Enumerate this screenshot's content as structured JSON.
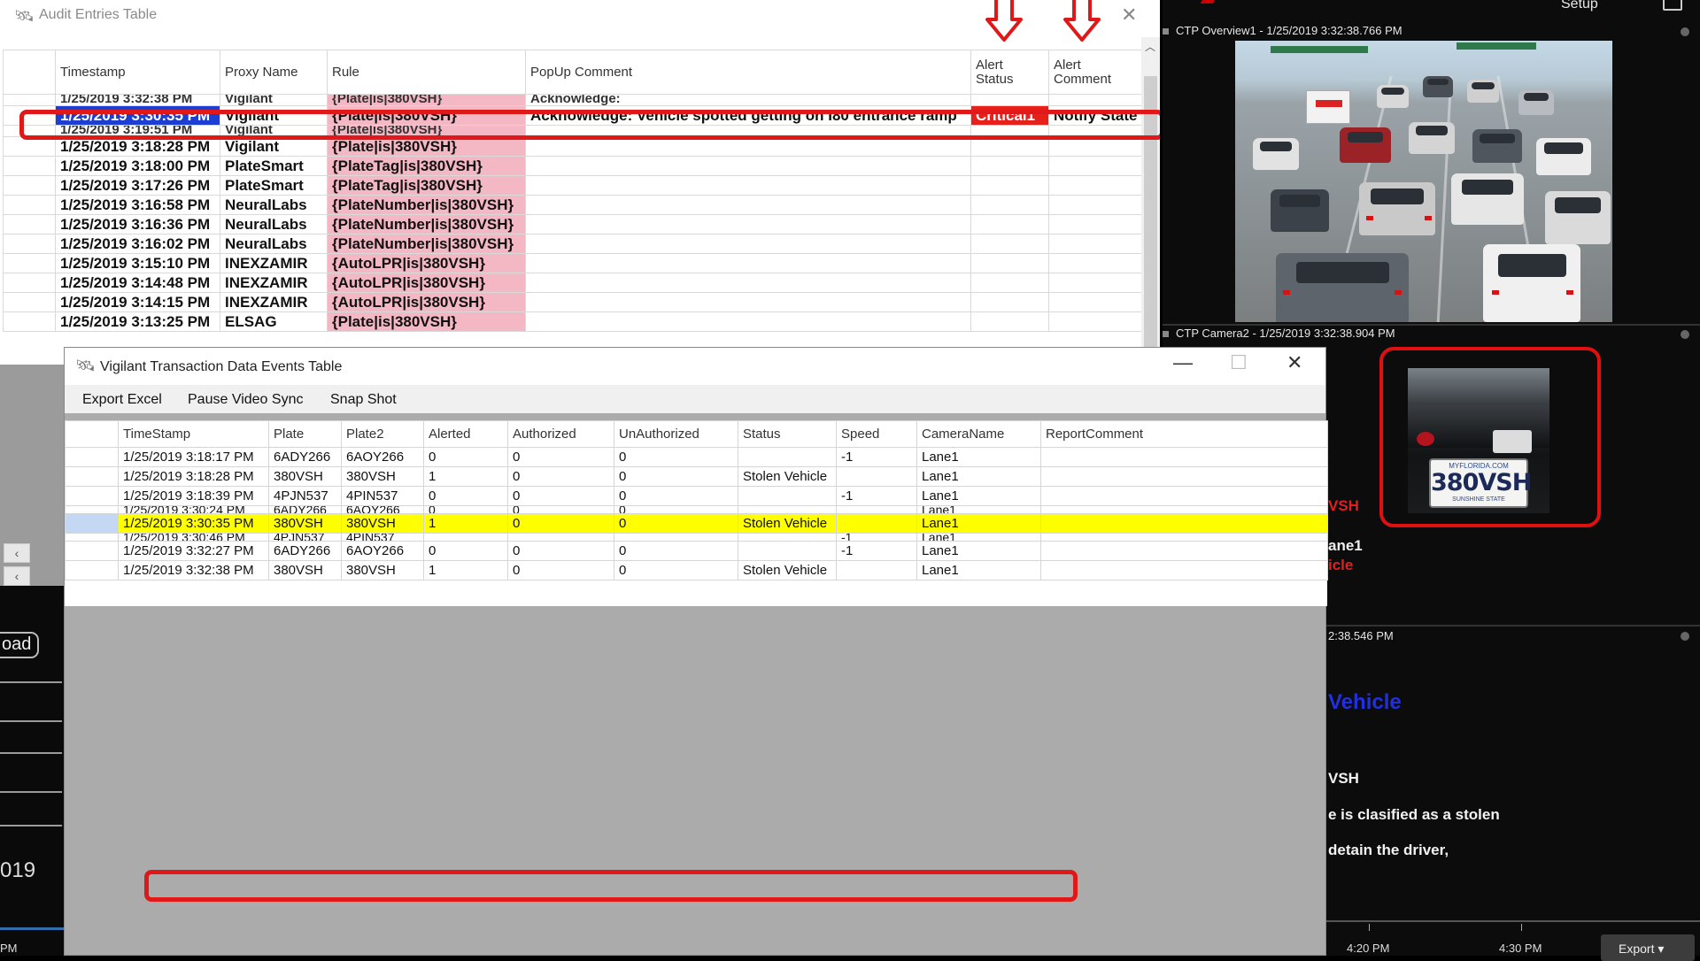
{
  "audit": {
    "title": "Audit Entries Table",
    "columns": [
      "",
      "Timestamp",
      "Proxy Name",
      "Rule",
      "PopUp Comment",
      "Alert Status",
      "Alert Comment"
    ],
    "top_partial": [
      "",
      "1/25/2019 3:32:38 PM",
      "Vigilant",
      "{Plate|is|380VSH}",
      "Acknowledge:",
      "",
      ""
    ],
    "selected_row": {
      "timestamp": "1/25/2019 3:30:35 PM",
      "proxy": "Vigilant",
      "rule": "{Plate|is|380VSH}",
      "comment": "Acknowledge: Vehicle spotted getting on I80 entrance ramp",
      "status": "Critical1",
      "alert_comment": "Notify State"
    },
    "partial_after": [
      "",
      "1/25/2019 3:19:51 PM",
      "Vigilant",
      "{Plate|is|380VSH}",
      "",
      "",
      ""
    ],
    "rows": [
      [
        "1/25/2019 3:18:28 PM",
        "Vigilant",
        "{Plate|is|380VSH}"
      ],
      [
        "1/25/2019 3:18:00 PM",
        "PlateSmart",
        "{PlateTag|is|380VSH}"
      ],
      [
        "1/25/2019 3:17:26 PM",
        "PlateSmart",
        "{PlateTag|is|380VSH}"
      ],
      [
        "1/25/2019 3:16:58 PM",
        "NeuralLabs",
        "{PlateNumber|is|380VSH}"
      ],
      [
        "1/25/2019 3:16:36 PM",
        "NeuralLabs",
        "{PlateNumber|is|380VSH}"
      ],
      [
        "1/25/2019 3:16:02 PM",
        "NeuralLabs",
        "{PlateNumber|is|380VSH}"
      ],
      [
        "1/25/2019 3:15:10 PM",
        "INEXZAMIR",
        "{AutoLPR|is|380VSH}"
      ],
      [
        "1/25/2019 3:14:48 PM",
        "INEXZAMIR",
        "{AutoLPR|is|380VSH}"
      ],
      [
        "1/25/2019 3:14:15 PM",
        "INEXZAMIR",
        "{AutoLPR|is|380VSH}"
      ],
      [
        "1/25/2019 3:13:25 PM",
        "ELSAG",
        "{Plate|is|380VSH}"
      ]
    ]
  },
  "vigilant": {
    "title": "Vigilant Transaction Data Events Table",
    "menu": [
      "Export Excel",
      "Pause Video Sync",
      "Snap Shot"
    ],
    "window_controls": {
      "minimize": "—",
      "maximize": "☐",
      "close": "✕"
    },
    "columns": [
      "",
      "TimeStamp",
      "Plate",
      "Plate2",
      "Alerted",
      "Authorized",
      "UnAuthorized",
      "Status",
      "Speed",
      "CameraName",
      "ReportComment"
    ],
    "rows": [
      [
        "1/25/2019 3:18:17 PM",
        "6ADY266",
        "6AOY266",
        "0",
        "0",
        "0",
        "",
        "-1",
        "Lane1",
        ""
      ],
      [
        "1/25/2019 3:18:28 PM",
        "380VSH",
        "380VSH",
        "1",
        "0",
        "0",
        "Stolen Vehicle",
        "",
        "Lane1",
        ""
      ],
      [
        "1/25/2019 3:18:39 PM",
        "4PJN537",
        "4PIN537",
        "0",
        "0",
        "0",
        "",
        "-1",
        "Lane1",
        ""
      ]
    ],
    "partial_before": [
      "1/25/2019 3:30:24 PM",
      "6ADY266",
      "6AOY266",
      "0",
      "0",
      "0",
      "",
      "",
      "Lane1",
      ""
    ],
    "highlight_row": [
      "1/25/2019 3:30:35 PM",
      "380VSH",
      "380VSH",
      "1",
      "0",
      "0",
      "Stolen Vehicle",
      "",
      "Lane1",
      ""
    ],
    "partial_after": [
      "1/25/2019 3:30:46 PM",
      "4PJN537",
      "4PIN537",
      "",
      "",
      "",
      "",
      "-1",
      "Lane1",
      ""
    ],
    "rows_after": [
      [
        "1/25/2019 3:32:27 PM",
        "6ADY266",
        "6AOY266",
        "0",
        "0",
        "0",
        "",
        "-1",
        "Lane1",
        ""
      ],
      [
        "1/25/2019 3:32:38 PM",
        "380VSH",
        "380VSH",
        "1",
        "0",
        "0",
        "Stolen Vehicle",
        "",
        "Lane1",
        ""
      ]
    ]
  },
  "right_panel": {
    "setup_label": "Setup",
    "camera1_title": "CTP Overview1 - 1/25/2019 3:32:38.766 PM",
    "camera2_title": "CTP Camera2 - 1/25/2019 3:32:38.904 PM",
    "camera3_title": "2:38.546 PM",
    "plate_top": "MYFLORIDA.COM",
    "plate_text": "380VSH",
    "plate_bottom": "SUNSHINE STATE",
    "alert_vsh": "VSH",
    "alert_lane": "ane1",
    "alert_icle": "icle",
    "vehicle_heading": "Vehicle",
    "msg_vsh": "VSH",
    "msg_line1": "e is clasified as a stolen",
    "msg_line2": "detain the driver,",
    "time_labels": [
      "4:20 PM",
      "4:30 PM"
    ],
    "export_label": "Export ▾"
  },
  "left_strip": {
    "load_label": "oad",
    "year_text": "019",
    "pm_text": "PM"
  },
  "colors": {
    "highlight_red": "#e01818",
    "rule_pink": "#f4b8c4",
    "selection_blue": "#1d3fd1",
    "row_yellow": "#ffff00",
    "alert_red": "#e02020",
    "alert_blue": "#2030e0"
  }
}
